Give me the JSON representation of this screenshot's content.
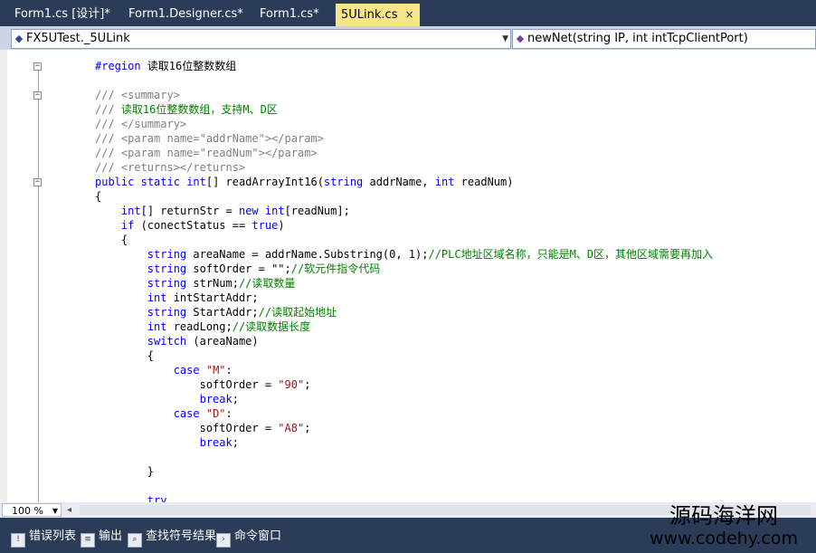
{
  "tabs": [
    {
      "label": "Form1.cs [设计]*"
    },
    {
      "label": "Form1.Designer.cs*"
    },
    {
      "label": "Form1.cs*"
    },
    {
      "label": "5ULink.cs",
      "close": "×"
    }
  ],
  "navbar": {
    "class_selector": "FX5UTest._5ULink",
    "member_selector": "newNet(string IP, int intTcpClientPort)"
  },
  "code": {
    "lines": [
      {
        "parts": [
          {
            "t": "#region 读取16位整数数组",
            "c": ""
          }
        ]
      },
      {
        "parts": []
      },
      {
        "parts": [
          {
            "t": "/// ",
            "c": "xd"
          },
          {
            "t": "<summary>",
            "c": "xd"
          }
        ]
      },
      {
        "parts": [
          {
            "t": "/// ",
            "c": "xd"
          },
          {
            "t": "读取16位整数数组，支持M、D区",
            "c": "cm"
          }
        ]
      },
      {
        "parts": [
          {
            "t": "/// </summary>",
            "c": "xd"
          }
        ]
      },
      {
        "parts": [
          {
            "t": "/// <param name=\"addrName\"></param>",
            "c": "xd"
          }
        ]
      },
      {
        "parts": [
          {
            "t": "/// <param name=\"readNum\"></param>",
            "c": "xd"
          }
        ]
      },
      {
        "parts": [
          {
            "t": "/// <returns></returns>",
            "c": "xd"
          }
        ]
      },
      {
        "parts": [
          {
            "t": "public static int[] readArrayInt16(string addrName, int readNum)",
            "c": ""
          }
        ]
      },
      {
        "parts": [
          {
            "t": "{",
            "c": ""
          }
        ]
      },
      {
        "parts": [
          {
            "t": "    int[] returnStr = new int[readNum];",
            "c": ""
          }
        ]
      },
      {
        "parts": [
          {
            "t": "    if (conectStatus == true)",
            "c": ""
          }
        ]
      },
      {
        "parts": [
          {
            "t": "    {",
            "c": ""
          }
        ]
      },
      {
        "parts": [
          {
            "t": "        string areaName = addrName.Substring(0, 1);",
            "c": ""
          },
          {
            "t": "//PLC地址区域名称，只能是M、D区，其他区域需要再加入",
            "c": "cm"
          }
        ]
      },
      {
        "parts": [
          {
            "t": "        string softOrder = \"\";",
            "c": ""
          },
          {
            "t": "//软元件指令代码",
            "c": "cm"
          }
        ]
      },
      {
        "parts": [
          {
            "t": "        string strNum;",
            "c": ""
          },
          {
            "t": "//读取数量",
            "c": "cm"
          }
        ]
      },
      {
        "parts": [
          {
            "t": "        int intStartAddr;",
            "c": ""
          }
        ]
      },
      {
        "parts": [
          {
            "t": "        string StartAddr;",
            "c": ""
          },
          {
            "t": "//读取起始地址",
            "c": "cm"
          }
        ]
      },
      {
        "parts": [
          {
            "t": "        int readLong;",
            "c": ""
          },
          {
            "t": "//读取数据长度",
            "c": "cm"
          }
        ]
      },
      {
        "parts": [
          {
            "t": "        switch (areaName)",
            "c": ""
          }
        ]
      },
      {
        "parts": [
          {
            "t": "        {",
            "c": ""
          }
        ]
      },
      {
        "parts": [
          {
            "t": "            case ",
            "c": ""
          },
          {
            "t": "\"M\"",
            "c": "str"
          },
          {
            "t": ":",
            "c": ""
          }
        ]
      },
      {
        "parts": [
          {
            "t": "                softOrder = ",
            "c": ""
          },
          {
            "t": "\"90\"",
            "c": "str"
          },
          {
            "t": ";",
            "c": ""
          }
        ]
      },
      {
        "parts": [
          {
            "t": "                break;",
            "c": ""
          }
        ]
      },
      {
        "parts": [
          {
            "t": "            case ",
            "c": ""
          },
          {
            "t": "\"D\"",
            "c": "str"
          },
          {
            "t": ":",
            "c": ""
          }
        ]
      },
      {
        "parts": [
          {
            "t": "                softOrder = ",
            "c": ""
          },
          {
            "t": "\"A8\"",
            "c": "str"
          },
          {
            "t": ";",
            "c": ""
          }
        ]
      },
      {
        "parts": [
          {
            "t": "                break;",
            "c": ""
          }
        ]
      },
      {
        "parts": []
      },
      {
        "parts": [
          {
            "t": "        }",
            "c": ""
          }
        ]
      },
      {
        "parts": []
      },
      {
        "parts": [
          {
            "t": "        try",
            "c": ""
          }
        ]
      }
    ]
  },
  "zoom": {
    "value": "100 %"
  },
  "bottom_tools": [
    {
      "label": "错误列表",
      "icon": "error-list-icon"
    },
    {
      "label": "输出",
      "icon": "output-icon"
    },
    {
      "label": "查找符号结果",
      "icon": "find-symbol-icon"
    },
    {
      "label": "命令窗口",
      "icon": "command-window-icon"
    }
  ],
  "watermark": {
    "line1": "源码海洋网",
    "line2": "www.codehy.com"
  },
  "colors": {
    "chrome": "#2b3c59",
    "active_tab": "#f7e58c",
    "keyword": "#0000ff",
    "comment": "#008000",
    "xmldoc": "#808080"
  }
}
